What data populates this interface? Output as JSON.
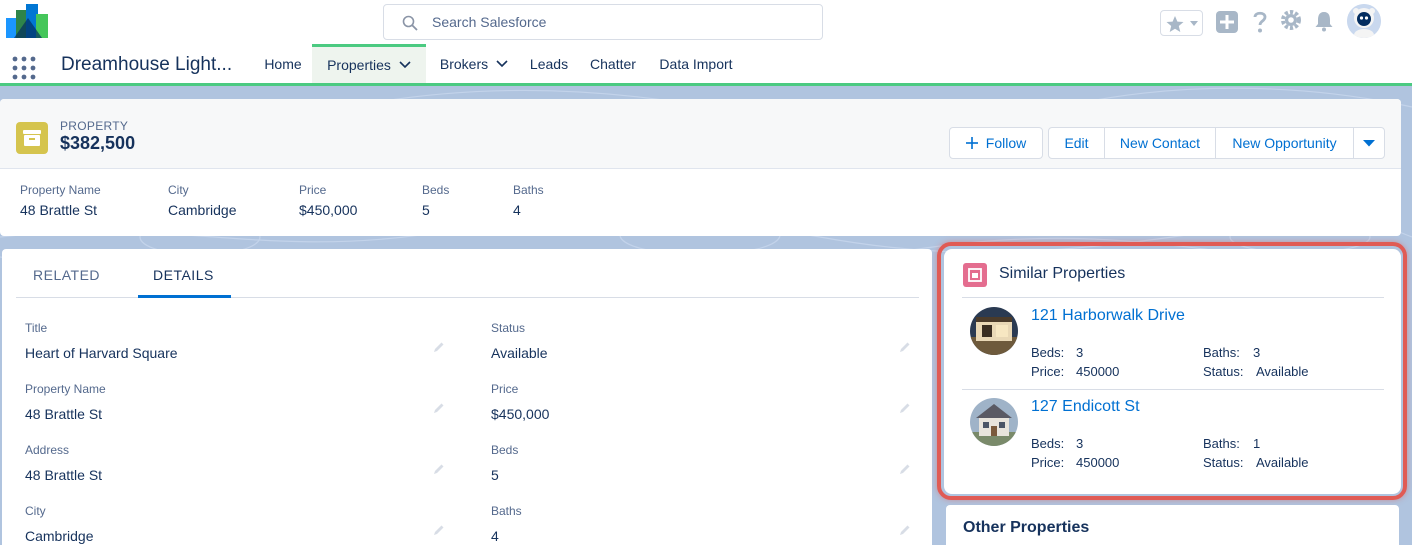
{
  "global_header": {
    "search_placeholder": "Search Salesforce",
    "icons": [
      "favorites-star-icon",
      "favorites-dropdown-icon",
      "global-create-icon",
      "help-icon",
      "setup-gear-icon",
      "notifications-bell-icon",
      "user-avatar"
    ]
  },
  "app_nav": {
    "app_name": "Dreamhouse Light...",
    "items": [
      {
        "label": "Home",
        "active": false,
        "has_menu": false
      },
      {
        "label": "Properties",
        "active": true,
        "has_menu": true
      },
      {
        "label": "Brokers",
        "active": false,
        "has_menu": true
      },
      {
        "label": "Leads",
        "active": false,
        "has_menu": false
      },
      {
        "label": "Chatter",
        "active": false,
        "has_menu": false
      },
      {
        "label": "Data Import",
        "active": false,
        "has_menu": false
      }
    ]
  },
  "record": {
    "object_type": "PROPERTY",
    "title": "$382,500",
    "actions": {
      "follow": "Follow",
      "edit": "Edit",
      "new_contact": "New Contact",
      "new_opportunity": "New Opportunity"
    },
    "highlights": [
      {
        "label": "Property Name",
        "value": "48 Brattle St"
      },
      {
        "label": "City",
        "value": "Cambridge"
      },
      {
        "label": "Price",
        "value": "$450,000"
      },
      {
        "label": "Beds",
        "value": "5"
      },
      {
        "label": "Baths",
        "value": "4"
      }
    ]
  },
  "tabs": {
    "related": "RELATED",
    "details": "DETAILS",
    "active": "DETAILS"
  },
  "details": {
    "left": [
      {
        "label": "Title",
        "value": "Heart of Harvard Square"
      },
      {
        "label": "Property Name",
        "value": "48 Brattle St"
      },
      {
        "label": "Address",
        "value": "48 Brattle St"
      },
      {
        "label": "City",
        "value": "Cambridge"
      }
    ],
    "right": [
      {
        "label": "Status",
        "value": "Available"
      },
      {
        "label": "Price",
        "value": "$450,000"
      },
      {
        "label": "Beds",
        "value": "5"
      },
      {
        "label": "Baths",
        "value": "4"
      }
    ]
  },
  "similar_properties": {
    "title": "Similar Properties",
    "items": [
      {
        "name": "121 Harborwalk Drive",
        "beds_label": "Beds:",
        "beds": "3",
        "baths_label": "Baths:",
        "baths": "3",
        "price_label": "Price:",
        "price": "450000",
        "status_label": "Status:",
        "status": "Available"
      },
      {
        "name": "127 Endicott St",
        "beds_label": "Beds:",
        "beds": "3",
        "baths_label": "Baths:",
        "baths": "1",
        "price_label": "Price:",
        "price": "450000",
        "status_label": "Status:",
        "status": "Available"
      }
    ]
  },
  "other_properties": {
    "title": "Other Properties"
  },
  "colors": {
    "link_blue": "#0070d2",
    "text_dark": "#16325c",
    "label_gray": "#54698d",
    "nav_active_green": "#4bca81",
    "property_icon_yellow": "#d5c44e",
    "similar_icon_pink": "#e46d8f",
    "highlight_red": "#e05b55",
    "page_bg_blue": "#b0c4df"
  }
}
